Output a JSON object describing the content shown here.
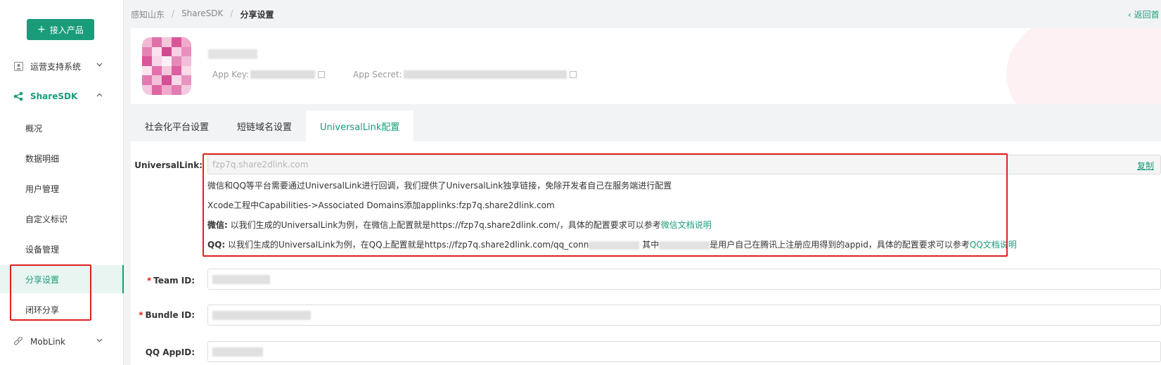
{
  "sidebar": {
    "add_button": "接入产品",
    "groups": [
      {
        "label": "运营支持系统",
        "icon": "person-card-icon"
      },
      {
        "label": "ShareSDK",
        "icon": "share-icon"
      },
      {
        "label": "MobLink",
        "icon": "link-icon"
      }
    ],
    "items": [
      "概况",
      "数据明细",
      "用户管理",
      "自定义标识",
      "设备管理",
      "分享设置",
      "闭环分享"
    ],
    "selected": "分享设置"
  },
  "breadcrumb": [
    "感知山东",
    "ShareSDK",
    "分享设置"
  ],
  "back_link": "‹ 返回首",
  "app": {
    "key_label": "App Key:",
    "secret_label": "App Secret:"
  },
  "tabs": [
    "社会化平台设置",
    "短链域名设置",
    "UniversalLink配置"
  ],
  "active_tab": "UniversalLink配置",
  "form": {
    "universal_link_label": "UniversalLink:",
    "universal_link_value": "fzp7q.share2dlink.com",
    "copy_label": "复制",
    "hint1": "微信和QQ等平台需要通过UniversalLink进行回调，我们提供了UniversalLink独享链接，免除开发者自己在服务端进行配置",
    "hint2": "Xcode工程中Capabilities->Associated Domains添加applinks:fzp7q.share2dlink.com",
    "hint3_prefix": "微信:",
    "hint3_text": "以我们生成的UniversalLink为例，在微信上配置就是https://fzp7q.share2dlink.com/，具体的配置要求可以参考",
    "hint3_link": "微信文档说明",
    "hint4_prefix": "QQ:",
    "hint4_text_a": "以我们生成的UniversalLink为例，在QQ上配置就是https://fzp7q.share2dlink.com/qq_conn",
    "hint4_text_b": "其中",
    "hint4_text_c": "是用户自己在腾讯上注册应用得到的appid，具体的配置要求可以参考",
    "hint4_link": "QQ文档说明",
    "team_id_label": "Team ID:",
    "bundle_id_label": "Bundle ID:",
    "qq_appid_label": "QQ AppID:"
  },
  "colors": {
    "accent": "#1a9c7a",
    "highlight_border": "#e02020",
    "required": "#e02020"
  }
}
